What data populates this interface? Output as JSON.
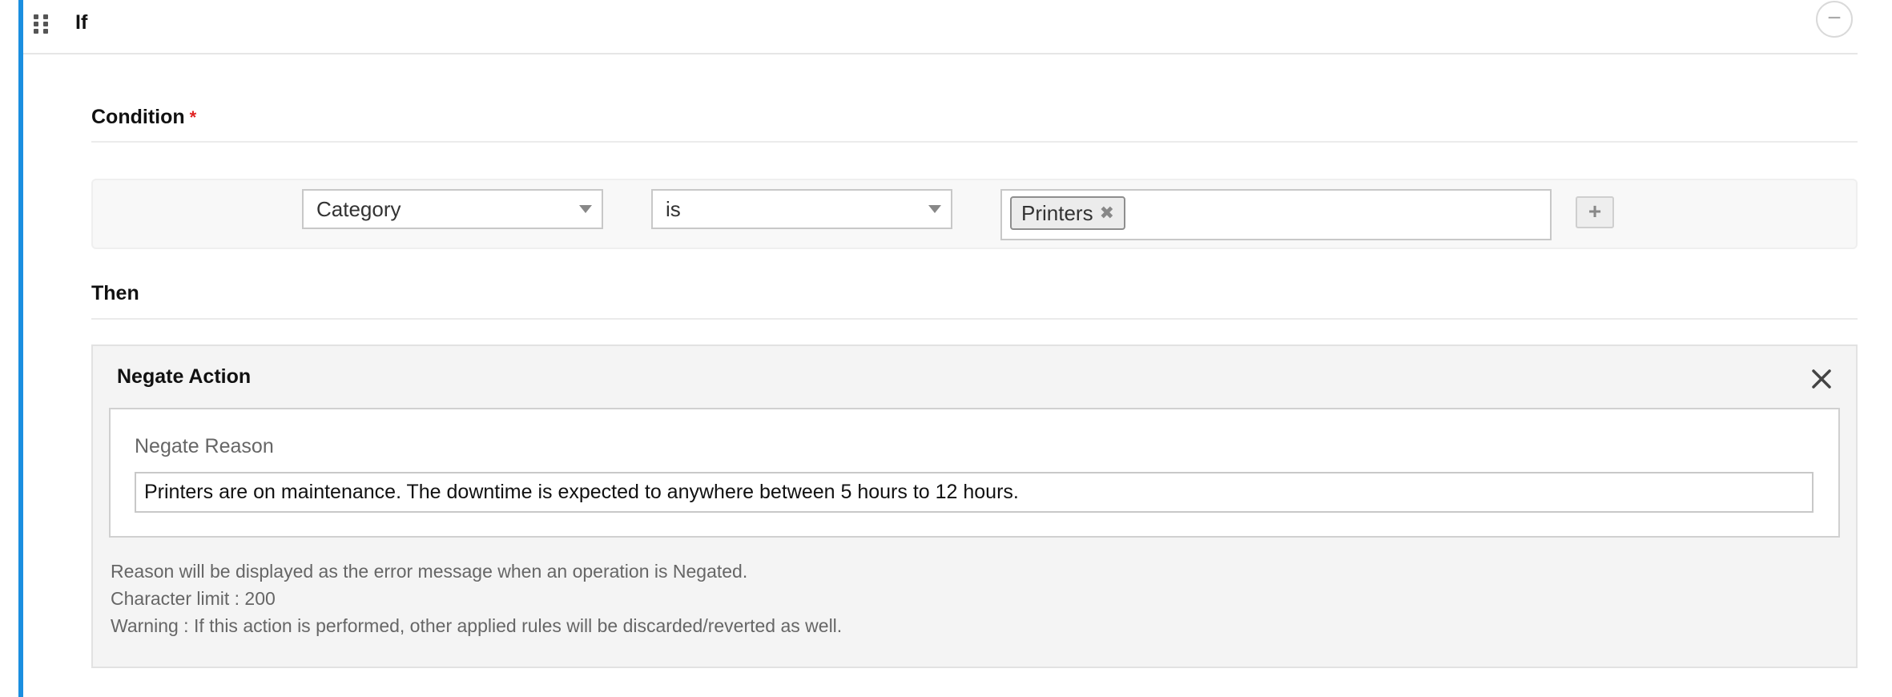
{
  "rule": {
    "header_title": "If",
    "collapse_symbol": "−"
  },
  "condition": {
    "title": "Condition",
    "required_marker": "*",
    "field_select": "Category",
    "operator_select": "is",
    "tags": [
      "Printers"
    ],
    "tag_remove_symbol": "✖",
    "add_symbol": "+"
  },
  "then": {
    "title": "Then",
    "action": {
      "title": "Negate Action",
      "reason_label": "Negate Reason",
      "reason_value": "Printers are on maintenance. The downtime is expected to anywhere between 5 hours to 12 hours.",
      "help_lines": [
        "Reason will be displayed as the error message when an operation is Negated.",
        "Character limit : 200",
        "Warning : If this action is performed, other applied rules will be discarded/reverted as well."
      ]
    }
  },
  "colors": {
    "accent": "#1a8fe0",
    "required": "#e02424"
  },
  "icons": {
    "drag": "drag-handle-icon",
    "collapse": "minus-circle-icon",
    "caret": "caret-down-icon",
    "remove": "close-icon",
    "add": "plus-icon"
  }
}
